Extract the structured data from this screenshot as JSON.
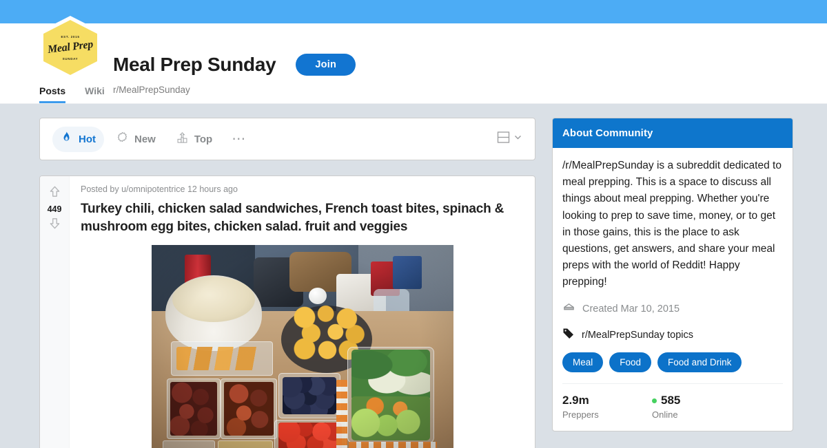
{
  "banner": {
    "color": "#4cacf5"
  },
  "community": {
    "logo": {
      "top_text": "EST. 2015",
      "main_text": "Meal Prep",
      "bottom_text": "SUNDAY"
    },
    "title": "Meal Prep Sunday",
    "subtitle": "r/MealPrepSunday",
    "join_label": "Join",
    "tabs": [
      {
        "label": "Posts",
        "active": true
      },
      {
        "label": "Wiki",
        "active": false
      }
    ]
  },
  "sortbar": {
    "options": [
      {
        "label": "Hot",
        "icon": "flame-icon",
        "active": true
      },
      {
        "label": "New",
        "icon": "sparkle-icon",
        "active": false
      },
      {
        "label": "Top",
        "icon": "podium-icon",
        "active": false
      }
    ],
    "more_label": "⋯",
    "view_icon": "card-view-icon",
    "view_chevron": "chevron-down-icon"
  },
  "post": {
    "vote_count": "449",
    "upvote_icon": "upvote-arrow-icon",
    "downvote_icon": "downvote-arrow-icon",
    "meta": "Posted by u/omnipotentrice 12 hours ago",
    "title": "Turkey chili, chicken salad sandwiches, French toast bites, spinach & mushroom egg bites, chicken salad. fruit and veggies",
    "image_alt": "Meal prep containers of turkey chili, chicken salad, egg bites, blueberries, strawberries and veggies on a kitchen counter"
  },
  "sidebar": {
    "header": "About Community",
    "description": "/r/MealPrepSunday is a subreddit dedicated to meal prepping. This is a space to discuss all things about meal prepping. Whether you're looking to prep to save time, money, or to get in those gains, this is the place to ask questions, get answers, and share your meal preps with the world of Reddit! Happy prepping!",
    "created": "Created Mar 10, 2015",
    "created_icon": "cake-icon",
    "topics_label": "r/MealPrepSunday topics",
    "topics_icon": "tag-icon",
    "topics": [
      "Meal",
      "Food",
      "Food and Drink"
    ],
    "stats": [
      {
        "value": "2.9m",
        "label": "Preppers",
        "dot": false
      },
      {
        "value": "585",
        "label": "Online",
        "dot": true
      }
    ]
  },
  "colors": {
    "banner_blue": "#4cacf5",
    "join_blue": "#1275d1",
    "about_header_blue": "#0e76cc",
    "pill_blue": "#0c72c9",
    "page_bg": "#dae0e6",
    "online_green": "#46d160",
    "logo_yellow": "#f6dd63"
  }
}
